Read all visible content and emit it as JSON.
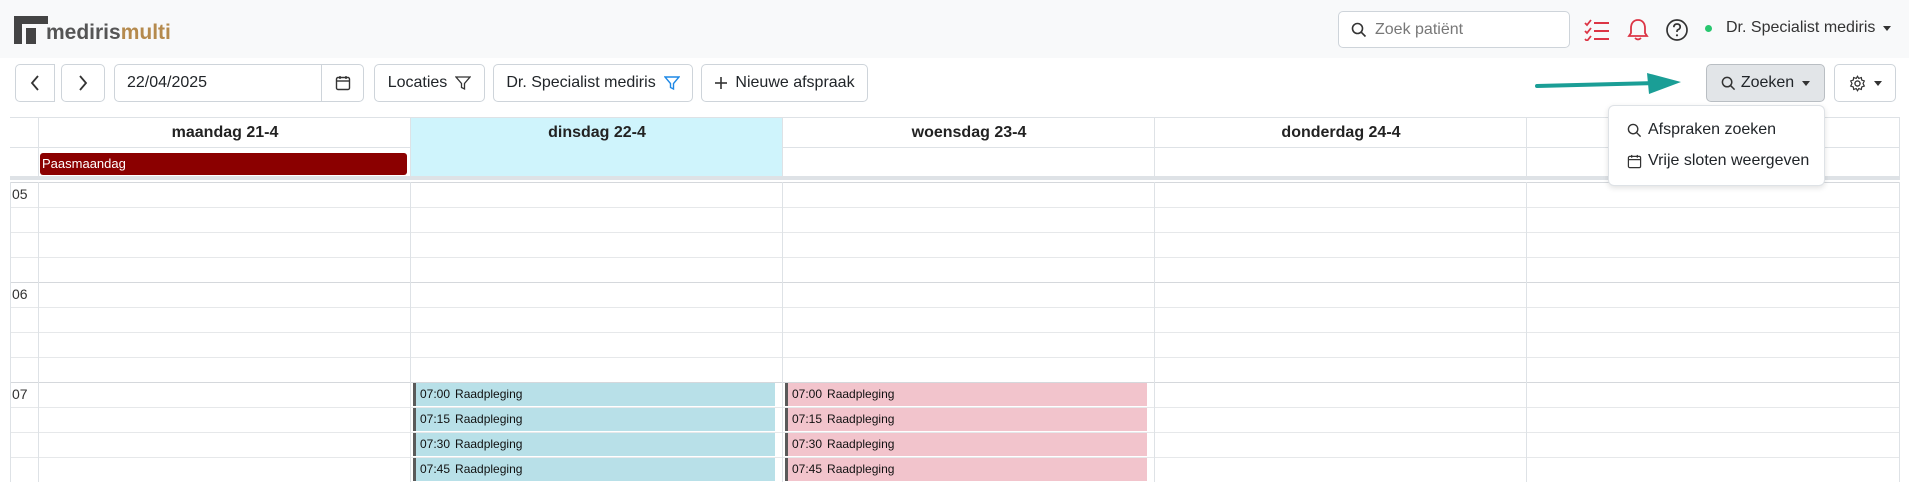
{
  "app": {
    "logo_prefix": "mediris",
    "logo_suffix": "multi"
  },
  "header": {
    "search_placeholder": "Zoek patiënt",
    "user_name": "Dr. Specialist mediris",
    "user_status": "online",
    "icons": [
      "tasks-icon",
      "bell-icon",
      "help-icon"
    ]
  },
  "toolbar": {
    "date_value": "22/04/2025",
    "locations_label": "Locaties",
    "doctor_filter_label": "Dr. Specialist mediris",
    "new_appointment_label": "Nieuwe afspraak",
    "search_label": "Zoeken"
  },
  "search_menu": {
    "items": [
      {
        "label": "Afspraken zoeken",
        "icon": "search-icon"
      },
      {
        "label": "Vrije sloten weergeven",
        "icon": "calendar-icon"
      }
    ]
  },
  "calendar": {
    "days": [
      {
        "label": "maandag 21-4",
        "today": false
      },
      {
        "label": "dinsdag 22-4",
        "today": true
      },
      {
        "label": "woensdag 23-4",
        "today": false
      },
      {
        "label": "donderdag 24-4",
        "today": false
      },
      {
        "label": "",
        "today": false
      }
    ],
    "all_day_event": {
      "label": "Paasmaandag",
      "day": 0,
      "color": "#8b0000"
    },
    "hours": [
      "05",
      "06",
      "07"
    ],
    "appointments_tuesday": [
      {
        "time": "07:00",
        "title": "Raadpleging"
      },
      {
        "time": "07:15",
        "title": "Raadpleging"
      },
      {
        "time": "07:30",
        "title": "Raadpleging"
      },
      {
        "time": "07:45",
        "title": "Raadpleging"
      }
    ],
    "appointments_wednesday": [
      {
        "time": "07:00",
        "title": "Raadpleging"
      },
      {
        "time": "07:15",
        "title": "Raadpleging"
      },
      {
        "time": "07:30",
        "title": "Raadpleging"
      },
      {
        "time": "07:45",
        "title": "Raadpleging"
      }
    ]
  },
  "colors": {
    "accent_arrow": "#1a9e96",
    "today_bg": "#cff4fc",
    "appt_blue": "#b8e0e8",
    "appt_pink": "#f2c4cc",
    "alert_red": "#dc3545"
  }
}
